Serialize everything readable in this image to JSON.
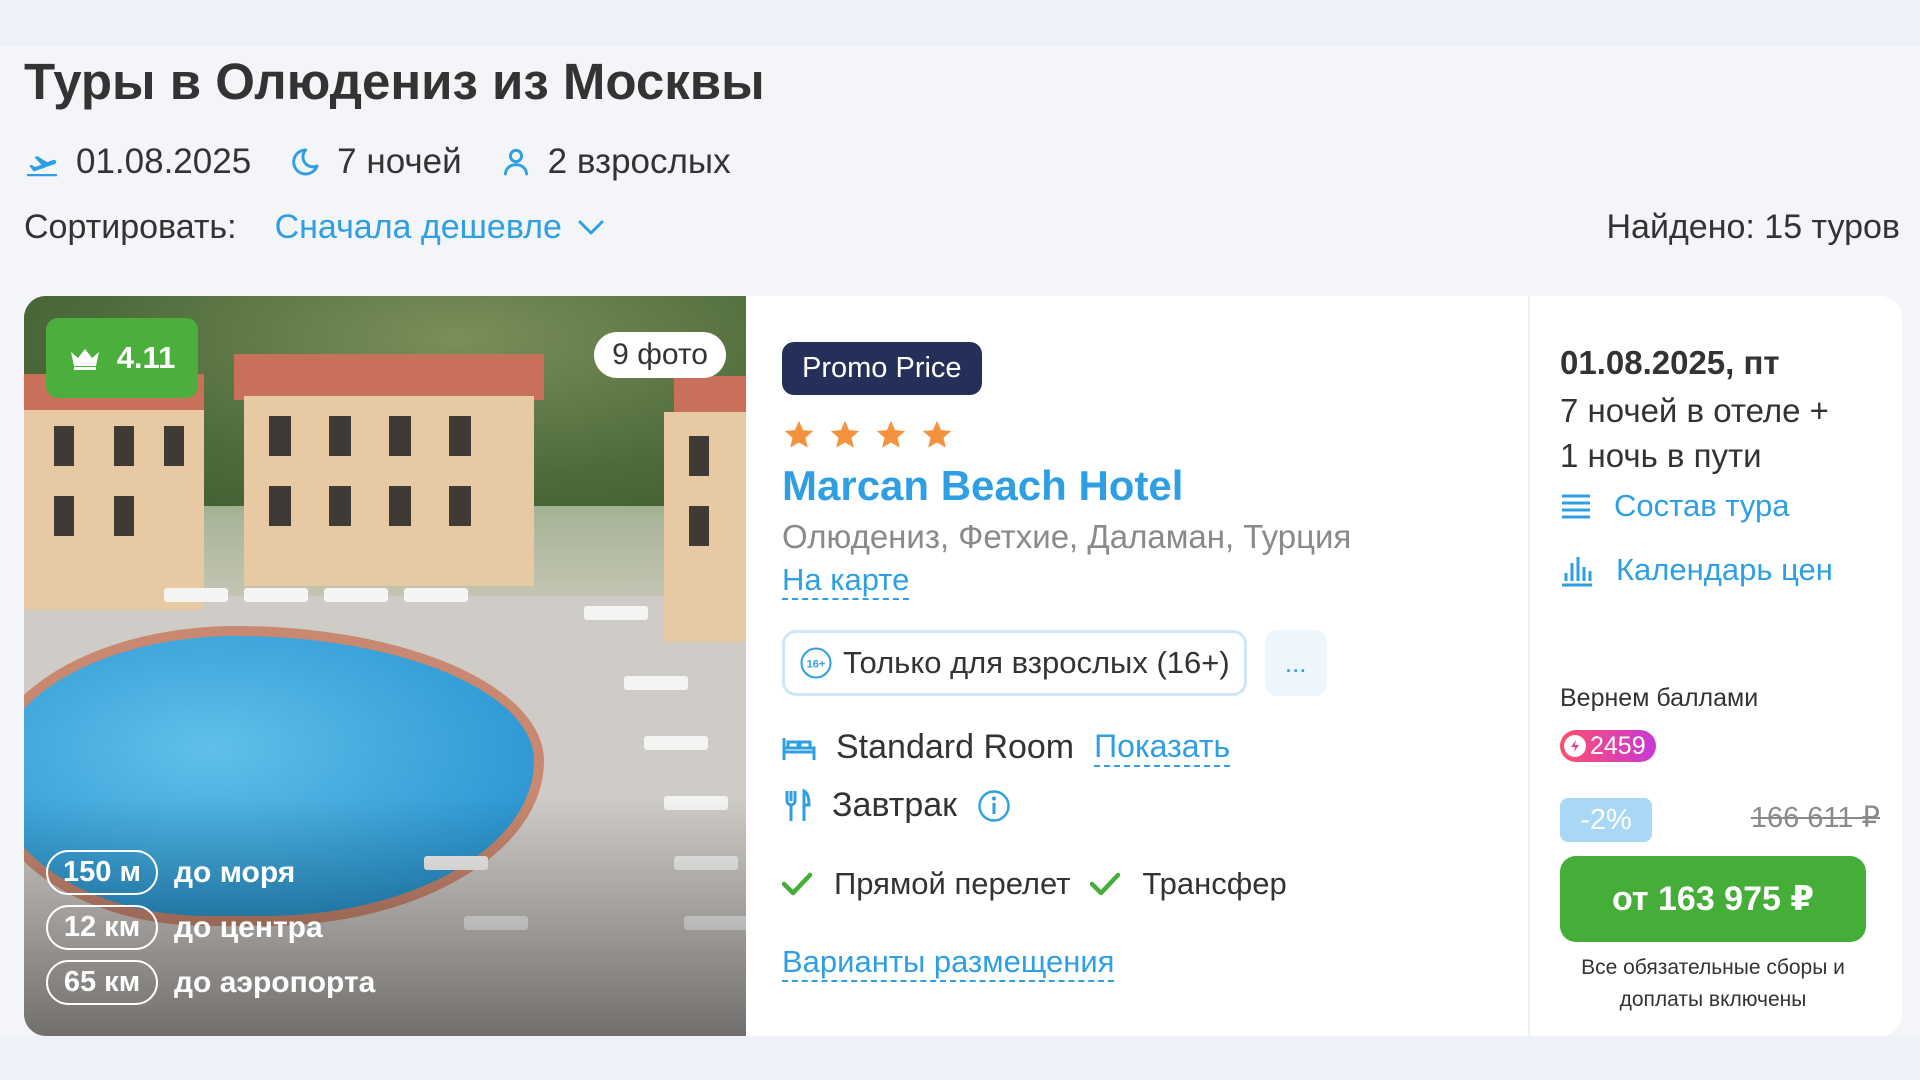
{
  "header": {
    "title": "Туры в Олюдениз из Москвы",
    "date": "01.08.2025",
    "nights": "7 ночей",
    "guests": "2 взрослых",
    "sort_label": "Сортировать:",
    "sort_value": "Сначала дешевле",
    "found": "Найдено: 15 туров"
  },
  "hotel": {
    "rating": "4.11",
    "photo_count": "9 фото",
    "distances": [
      {
        "value": "150 м",
        "label": "до моря"
      },
      {
        "value": "12 км",
        "label": "до центра"
      },
      {
        "value": "65 км",
        "label": "до аэропорта"
      }
    ],
    "promo": "Promo Price",
    "stars": 4,
    "name": "Marcan Beach Hotel",
    "location": "Олюдениз, Фетхие, Даламан, Турция",
    "map_link": "На карте",
    "tag": "Только для взрослых (16+)",
    "tag_icon_text": "16+",
    "more": "...",
    "room": "Standard Room",
    "room_show": "Показать",
    "meal": "Завтрак",
    "features": [
      "Прямой перелет",
      "Трансфер"
    ],
    "variants": "Варианты размещения"
  },
  "offer": {
    "date": "01.08.2025, пт",
    "nights_line1": "7 ночей в отеле +",
    "nights_line2": "1 ночь в пути",
    "tour_contents": "Состав тура",
    "price_calendar": "Календарь цен",
    "bonus_label": "Вернем баллами",
    "bonus_value": "2459",
    "discount": "-2%",
    "old_price": "166 611 ₽",
    "price": "от 163 975 ₽",
    "fees_note": "Все обязательные сборы и доплаты включены"
  },
  "colors": {
    "accent": "#2f9fe3",
    "green": "#44ae38",
    "promo": "#25305a",
    "star": "#f5923e"
  }
}
